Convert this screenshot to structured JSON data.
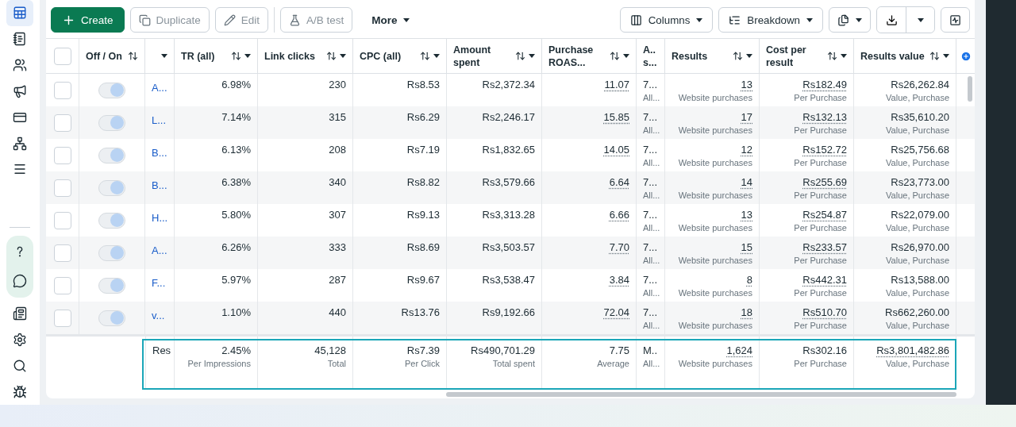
{
  "sidebar": {
    "items": [
      {
        "kind": "table",
        "selected": true
      },
      {
        "kind": "notebook",
        "selected": false
      },
      {
        "kind": "people",
        "selected": false
      },
      {
        "kind": "megaphone",
        "selected": false
      },
      {
        "kind": "card",
        "selected": false
      },
      {
        "kind": "network",
        "selected": false
      },
      {
        "kind": "menu",
        "selected": false
      }
    ],
    "help_items": [
      {
        "kind": "help"
      },
      {
        "kind": "chat"
      }
    ],
    "bottom_items": [
      {
        "kind": "news"
      },
      {
        "kind": "settings"
      },
      {
        "kind": "search"
      },
      {
        "kind": "bug"
      }
    ]
  },
  "toolbar": {
    "left": [
      {
        "label": "Create",
        "kind": "primary"
      },
      {
        "label": "Duplicate",
        "kind": "copy",
        "disabled": true
      },
      {
        "label": "Edit",
        "kind": "edit",
        "disabled": true
      },
      {
        "label": "A/B test",
        "kind": "flask",
        "disabled": true
      },
      {
        "label": "More",
        "kind": "menu"
      }
    ],
    "right": [
      {
        "label": "Columns",
        "kind": "columns"
      },
      {
        "label": "Breakdown",
        "kind": "breakdown"
      }
    ]
  },
  "table": {
    "select_all": {
      "checked": false
    },
    "toggle_header": {
      "label": "Off / On"
    },
    "columns": [
      {
        "kind": "number",
        "label": "TR (all)",
        "dotted": false
      },
      {
        "kind": "number",
        "label": "Link clicks",
        "dotted": false
      },
      {
        "kind": "number",
        "label": "CPC (all)",
        "dotted": false
      },
      {
        "kind": "number",
        "label": "Amount spent",
        "dotted": false
      },
      {
        "kind": "number",
        "label": "Purchase ROAS...",
        "dotted": true
      },
      {
        "kind": "text",
        "label": "A.. s...",
        "dotted": false
      },
      {
        "kind": "number",
        "label": "Results",
        "dotted": true
      },
      {
        "kind": "number",
        "label": "Cost per result",
        "dotted": true
      },
      {
        "kind": "number",
        "label": "Results value",
        "dotted": false
      }
    ],
    "rows": [
      {
        "checked": false,
        "on": true,
        "name": "A...",
        "cells": [
          {
            "value": "6.98%"
          },
          {
            "value": "230"
          },
          {
            "value": "Rs8.53"
          },
          {
            "value": "Rs2,372.34"
          },
          {
            "value": "11.07"
          },
          {
            "value": "7...",
            "sub": "All..."
          },
          {
            "value": "13",
            "sub": "Website purchases"
          },
          {
            "value": "Rs182.49",
            "sub": "Per Purchase"
          },
          {
            "value": "Rs26,262.84",
            "sub": "Value, Purchase"
          }
        ]
      },
      {
        "checked": false,
        "on": true,
        "name": "L...",
        "cells": [
          {
            "value": "7.14%"
          },
          {
            "value": "315"
          },
          {
            "value": "Rs6.29"
          },
          {
            "value": "Rs2,246.17"
          },
          {
            "value": "15.85"
          },
          {
            "value": "7...",
            "sub": "All..."
          },
          {
            "value": "17",
            "sub": "Website purchases"
          },
          {
            "value": "Rs132.13",
            "sub": "Per Purchase"
          },
          {
            "value": "Rs35,610.20",
            "sub": "Value, Purchase"
          }
        ]
      },
      {
        "checked": false,
        "on": true,
        "name": "B...",
        "cells": [
          {
            "value": "6.13%"
          },
          {
            "value": "208"
          },
          {
            "value": "Rs7.19"
          },
          {
            "value": "Rs1,832.65"
          },
          {
            "value": "14.05"
          },
          {
            "value": "7...",
            "sub": "All..."
          },
          {
            "value": "12",
            "sub": "Website purchases"
          },
          {
            "value": "Rs152.72",
            "sub": "Per Purchase"
          },
          {
            "value": "Rs25,756.68",
            "sub": "Value, Purchase"
          }
        ]
      },
      {
        "checked": false,
        "on": true,
        "name": "B...",
        "cells": [
          {
            "value": "6.38%"
          },
          {
            "value": "340"
          },
          {
            "value": "Rs8.82"
          },
          {
            "value": "Rs3,579.66"
          },
          {
            "value": "6.64"
          },
          {
            "value": "7...",
            "sub": "All..."
          },
          {
            "value": "14",
            "sub": "Website purchases"
          },
          {
            "value": "Rs255.69",
            "sub": "Per Purchase"
          },
          {
            "value": "Rs23,773.00",
            "sub": "Value, Purchase"
          }
        ]
      },
      {
        "checked": false,
        "on": true,
        "name": "H...",
        "cells": [
          {
            "value": "5.80%"
          },
          {
            "value": "307"
          },
          {
            "value": "Rs9.13"
          },
          {
            "value": "Rs3,313.28"
          },
          {
            "value": "6.66"
          },
          {
            "value": "7...",
            "sub": "All..."
          },
          {
            "value": "13",
            "sub": "Website purchases"
          },
          {
            "value": "Rs254.87",
            "sub": "Per Purchase"
          },
          {
            "value": "Rs22,079.00",
            "sub": "Value, Purchase"
          }
        ]
      },
      {
        "checked": false,
        "on": true,
        "name": "A...",
        "cells": [
          {
            "value": "6.26%"
          },
          {
            "value": "333"
          },
          {
            "value": "Rs8.69"
          },
          {
            "value": "Rs3,503.57"
          },
          {
            "value": "7.70"
          },
          {
            "value": "7...",
            "sub": "All..."
          },
          {
            "value": "15",
            "sub": "Website purchases"
          },
          {
            "value": "Rs233.57",
            "sub": "Per Purchase"
          },
          {
            "value": "Rs26,970.00",
            "sub": "Value, Purchase"
          }
        ]
      },
      {
        "checked": false,
        "on": true,
        "name": "F...",
        "cells": [
          {
            "value": "5.97%"
          },
          {
            "value": "287"
          },
          {
            "value": "Rs9.67"
          },
          {
            "value": "Rs3,538.47"
          },
          {
            "value": "3.84"
          },
          {
            "value": "7...",
            "sub": "All..."
          },
          {
            "value": "8",
            "sub": "Website purchases"
          },
          {
            "value": "Rs442.31",
            "sub": "Per Purchase"
          },
          {
            "value": "Rs13,588.00",
            "sub": "Value, Purchase"
          }
        ]
      },
      {
        "checked": false,
        "on": true,
        "name": "v...",
        "cells": [
          {
            "value": "1.10%"
          },
          {
            "value": "440"
          },
          {
            "value": "Rs13.76"
          },
          {
            "value": "Rs9,192.66"
          },
          {
            "value": "72.04"
          },
          {
            "value": "7...",
            "sub": "All..."
          },
          {
            "value": "18",
            "sub": "Website purchases"
          },
          {
            "value": "Rs510.70",
            "sub": "Per Purchase"
          },
          {
            "value": "Rs662,260.00",
            "sub": "Value, Purchase"
          }
        ]
      }
    ],
    "totals": {
      "name": "Res",
      "cells": [
        {
          "value": "2.45%",
          "sub": "Per Impressions",
          "dotted": false
        },
        {
          "value": "45,128",
          "sub": "Total",
          "dotted": false
        },
        {
          "value": "Rs7.39",
          "sub": "Per Click",
          "dotted": false
        },
        {
          "value": "Rs490,701.29",
          "sub": "Total spent",
          "dotted": false
        },
        {
          "value": "7.75",
          "sub": "Average",
          "dotted": false
        },
        {
          "value": "M..",
          "sub": "All...",
          "dotted": false
        },
        {
          "value": "1,624",
          "sub": "Website purchases",
          "dotted": true
        },
        {
          "value": "Rs302.16",
          "sub": "Per Purchase",
          "dotted": false
        },
        {
          "value": "Rs3,801,482.86",
          "sub": "Value, Purchase",
          "dotted": true
        }
      ]
    }
  }
}
